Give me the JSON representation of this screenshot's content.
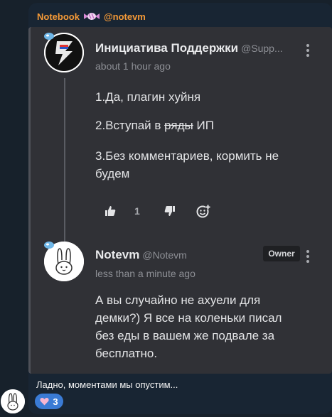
{
  "header": {
    "channel_name": "Notebook",
    "channel_emoji_icon": "candy-icon",
    "author_tag": "@notevm"
  },
  "post1": {
    "author_name": "Инициатива Поддержки",
    "author_handle": "@Supp...",
    "time": "about 1 hour ago",
    "avatar_icon": "lightning-avatar",
    "lines": {
      "l1": "1.Да, плагин хуйня",
      "l2_prefix": "2.Вступай в ",
      "l2_strike": "ряды",
      "l2_suffix": " ИП",
      "l3a": "3.Без комментариев, кормить не",
      "l3b": "будем"
    },
    "like_count": "1"
  },
  "post2": {
    "author_name": "Notevm",
    "author_handle": "@Notevm",
    "owner_badge": "Owner",
    "time": "less than a minute ago",
    "avatar_icon": "bunny-avatar",
    "lines": {
      "a": "А вы случайно не ахуели для",
      "b": "демки?) Я все на коленьки писал",
      "c": "без еды в вашем же подвале за",
      "d": "бесплатно."
    }
  },
  "footer": {
    "caption": "Ладно, моментами мы опустим...",
    "reaction_icon": "heart-icon",
    "reaction_count": "3"
  },
  "colors": {
    "accent_name": "#f59a37",
    "card_bg": "#303136",
    "reaction_bg": "#3a7bd5"
  }
}
